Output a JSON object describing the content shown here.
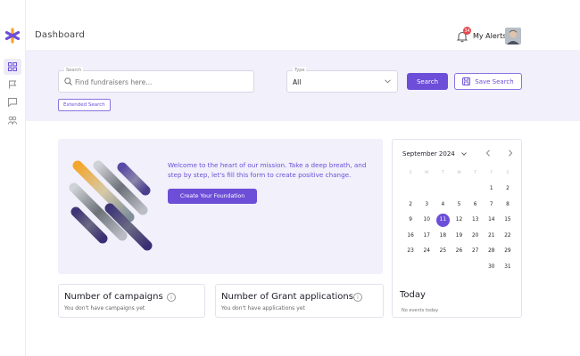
{
  "header": {
    "title": "Dashboard",
    "alerts_count": "34",
    "alerts_label": "My Alerts"
  },
  "sidebar": {
    "items": [
      {
        "icon": "dashboard-grid-icon",
        "active": true
      },
      {
        "icon": "flag-icon",
        "active": false
      },
      {
        "icon": "chat-icon",
        "active": false
      },
      {
        "icon": "users-icon",
        "active": false
      }
    ]
  },
  "search": {
    "label": "Search",
    "placeholder": "Find fundraisers here...",
    "type_label": "Type",
    "type_value": "All",
    "search_button": "Search",
    "save_button": "Save Search",
    "extended_button": "Extended Search"
  },
  "hero": {
    "text": "Welcome to the heart of our mission. Take a deep breath, and step by step, let's fill this form to create positive change.",
    "button": "Create Your Foundation"
  },
  "stats": {
    "campaigns": {
      "title": "Number of campaigns",
      "subtitle": "You don't have campaigns yet"
    },
    "grants": {
      "title": "Number of Grant applications",
      "subtitle": "You don't have applications yet"
    }
  },
  "calendar": {
    "month": "September 2024",
    "weekdays": [
      "S",
      "M",
      "T",
      "W",
      "T",
      "F",
      "S"
    ],
    "days": [
      "",
      "",
      "",
      "",
      "",
      "1",
      "2",
      "2",
      "3",
      "4",
      "5",
      "6",
      "7",
      "8",
      "9",
      "10",
      "11",
      "12",
      "13",
      "14",
      "15",
      "16",
      "17",
      "18",
      "19",
      "20",
      "21",
      "22",
      "23",
      "24",
      "25",
      "26",
      "27",
      "28",
      "29",
      "",
      "",
      "",
      "",
      "",
      "30",
      "31"
    ],
    "selected": "11"
  },
  "today": {
    "title": "Today",
    "subtitle": "No events today"
  },
  "colors": {
    "accent": "#6c4ed8",
    "band": "#f1f0fb",
    "logo_orange": "#f4a62a",
    "logo_purple": "#6c4ed8"
  }
}
